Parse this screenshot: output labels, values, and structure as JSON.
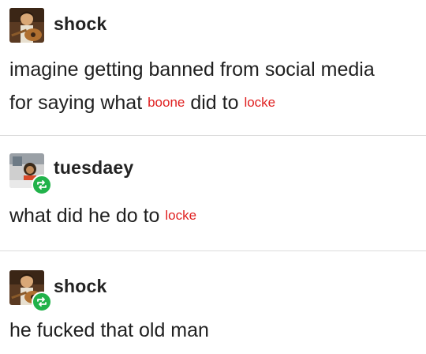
{
  "posts": [
    {
      "username": "shock",
      "reblog": false,
      "line1": "imagine getting banned from social media",
      "line2_part1": "for saying what ",
      "line2_red1": "boone",
      "line2_part2": " did to ",
      "line2_red2": "locke"
    },
    {
      "username": "tuesdaey",
      "reblog": true,
      "line1_part1": "what did he do to ",
      "line1_red": "locke"
    },
    {
      "username": "shock",
      "reblog": true,
      "line1": "he fucked that old man"
    }
  ],
  "colors": {
    "text": "#202020",
    "annotation_red": "#e02020",
    "reblog_green": "#21b24a",
    "divider": "#dcdcdc"
  },
  "icons": [
    "avatar-shock",
    "avatar-tuesdaey",
    "reblog-icon"
  ]
}
